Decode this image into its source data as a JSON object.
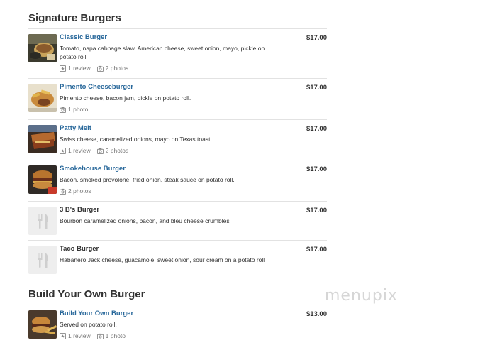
{
  "sections": [
    {
      "title": "Signature Burgers",
      "items": [
        {
          "name": "Classic Burger",
          "description": "Tomato, napa cabbage slaw, American cheese, sweet onion, mayo, pickle on potato roll.",
          "price": "$17.00",
          "reviews": "1 review",
          "photos": "2 photos"
        },
        {
          "name": "Pimento Cheeseburger",
          "description": "Pimento cheese, bacon jam, pickle on potato roll.",
          "price": "$17.00",
          "photos": "1 photo"
        },
        {
          "name": "Patty Melt",
          "description": "Swiss cheese, caramelized onions, mayo on Texas toast.",
          "price": "$17.00",
          "reviews": "1 review",
          "photos": "2 photos"
        },
        {
          "name": "Smokehouse Burger",
          "description": "Bacon, smoked provolone, fried onion, steak sauce on potato roll.",
          "price": "$17.00",
          "photos": "2 photos"
        },
        {
          "name": "3 B's Burger",
          "description": "Bourbon caramelized onions, bacon, and bleu cheese crumbles",
          "price": "$17.00"
        },
        {
          "name": "Taco Burger",
          "description": "Habanero Jack cheese, guacamole, sweet onion, sour cream on a potato roll",
          "price": "$17.00"
        }
      ]
    },
    {
      "title": "Build Your Own Burger",
      "items": [
        {
          "name": "Build Your Own Burger",
          "description": "Served on potato roll.",
          "price": "$13.00",
          "reviews": "1 review",
          "photos": "1 photo"
        }
      ]
    }
  ],
  "watermark": "menupix",
  "colors": {
    "link": "#27679a",
    "text": "#333333",
    "muted": "#777777",
    "divider": "#e2e2e2"
  },
  "icons": {
    "review": "review-icon",
    "photo": "camera-icon",
    "placeholder": "fork-knife-icon"
  }
}
